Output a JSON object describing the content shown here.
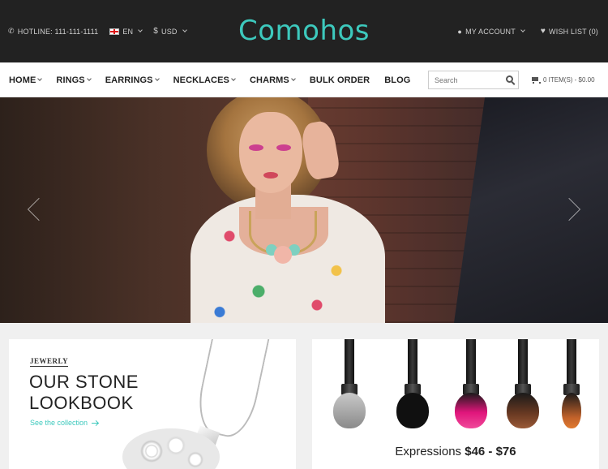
{
  "topbar": {
    "hotline": "HOTLINE: 111-111-1111",
    "language": "EN",
    "currency": "USD",
    "currency_symbol": "$",
    "logo": "Comohos",
    "account": "MY ACCOUNT",
    "wishlist": "WISH LIST (0)"
  },
  "nav": {
    "items": [
      {
        "label": "HOME",
        "has_dropdown": true
      },
      {
        "label": "RINGS",
        "has_dropdown": true
      },
      {
        "label": "EARRINGS",
        "has_dropdown": true
      },
      {
        "label": "NECKLACES",
        "has_dropdown": true
      },
      {
        "label": "CHARMS",
        "has_dropdown": true
      },
      {
        "label": "BULK ORDER",
        "has_dropdown": false
      },
      {
        "label": "BLOG",
        "has_dropdown": false
      }
    ],
    "search_placeholder": "Search",
    "cart": "0 ITEM(S) - $0.00"
  },
  "banners": {
    "lookbook": {
      "tag": "JEWERLY",
      "title_line1": "OUR STONE",
      "title_line2": "LOOKBOOK",
      "link": "See the collection"
    },
    "expressions": {
      "label": "Expressions",
      "price": "$46 - $76"
    }
  },
  "colors": {
    "accent": "#3dc9bd",
    "topbar_bg": "#222222"
  }
}
